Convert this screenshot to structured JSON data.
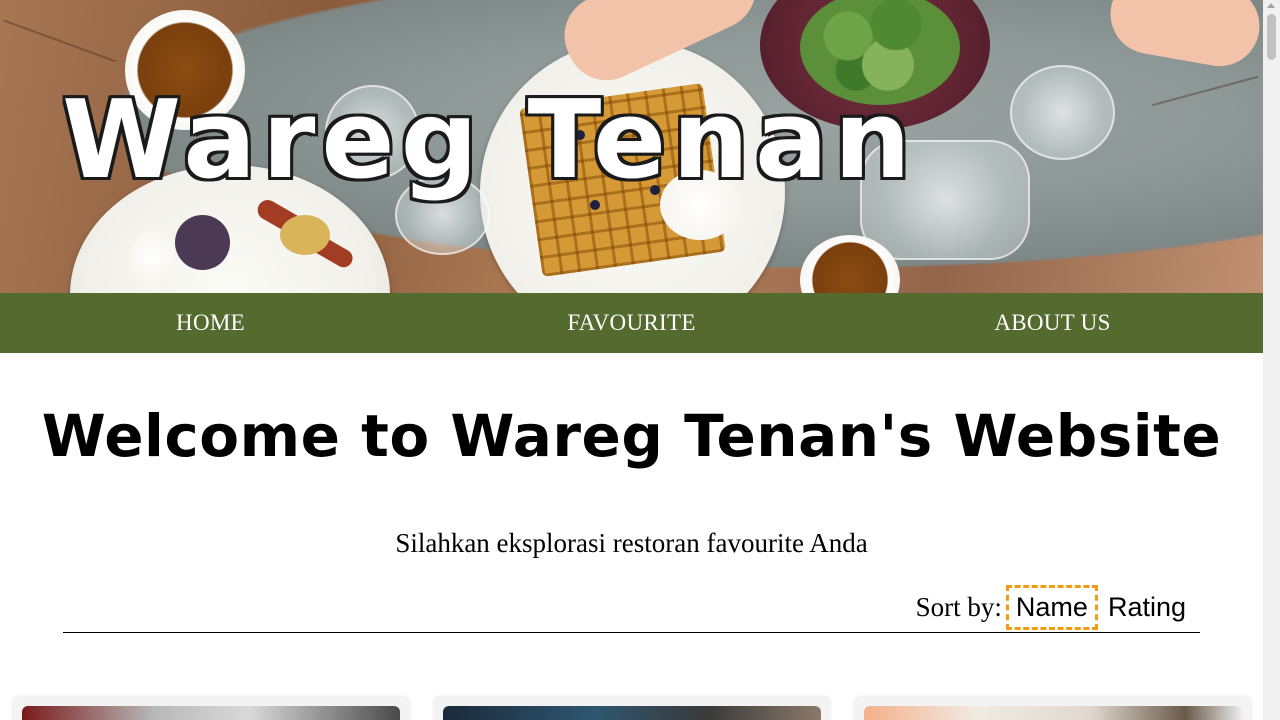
{
  "hero": {
    "title": "Wareg Tenan"
  },
  "nav": {
    "items": [
      {
        "label": "HOME"
      },
      {
        "label": "FAVOURITE"
      },
      {
        "label": "ABOUT US"
      }
    ]
  },
  "main": {
    "heading": "Welcome to Wareg Tenan's Website",
    "subtitle": "Silahkan eksplorasi restoran favourite Anda",
    "sort": {
      "label": "Sort by:",
      "options": [
        "Name",
        "Rating"
      ],
      "active": "Name"
    }
  },
  "colors": {
    "nav_bg": "#546a2f",
    "nav_text": "#ffffff",
    "focus_outline": "#f39c12"
  },
  "icons": {
    "scroll_up": "chevron-up-icon"
  }
}
